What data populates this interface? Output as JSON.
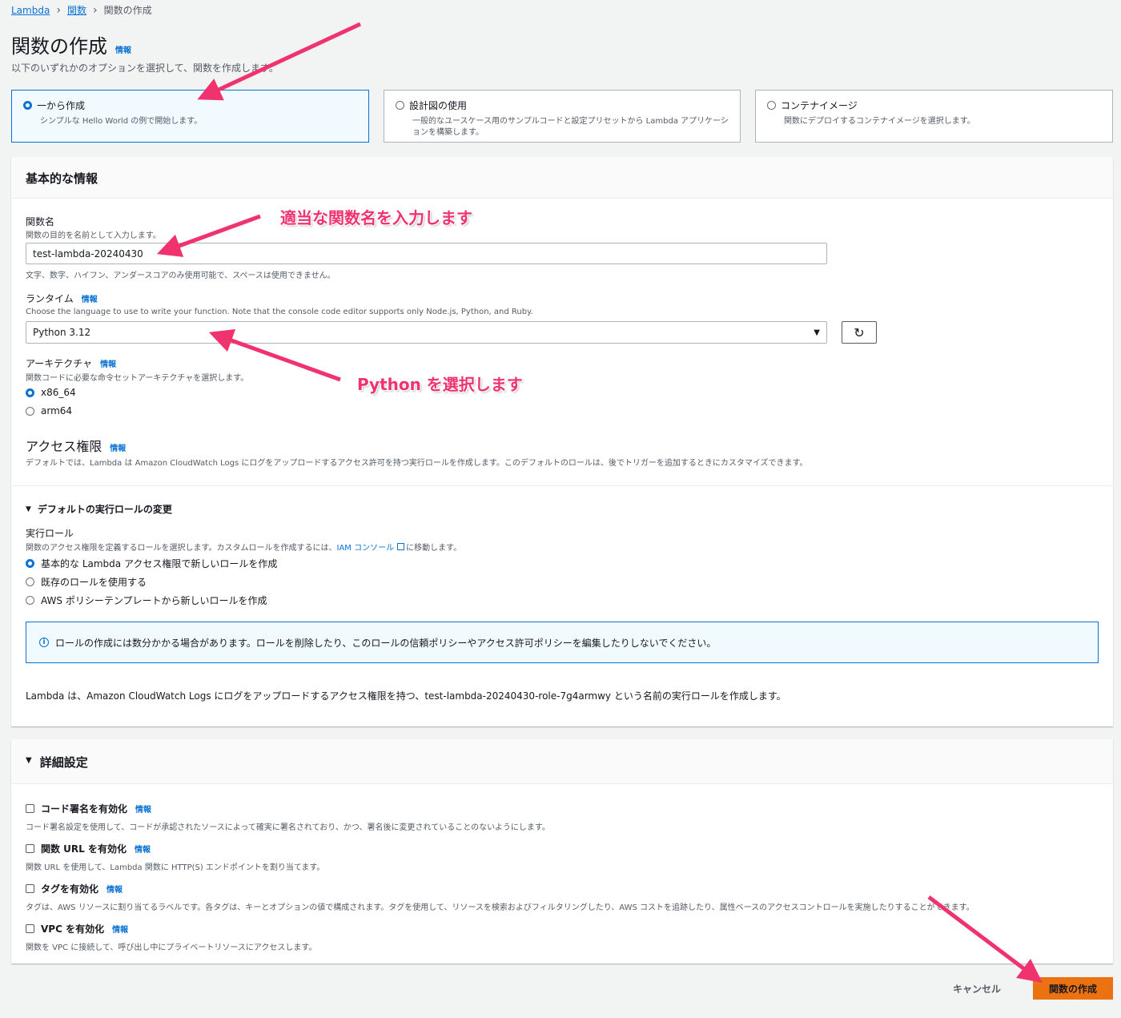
{
  "breadcrumb": {
    "root": "Lambda",
    "functions": "関数",
    "current": "関数の作成"
  },
  "page": {
    "title": "関数の作成",
    "info": "情報",
    "subtitle": "以下のいずれかのオプションを選択して、関数を作成します。"
  },
  "options": [
    {
      "title": "一から作成",
      "desc": "シンプルな Hello World の例で開始します。",
      "selected": true
    },
    {
      "title": "設計図の使用",
      "desc": "一般的なユースケース用のサンプルコードと設定プリセットから Lambda アプリケーションを構築します。",
      "selected": false
    },
    {
      "title": "コンテナイメージ",
      "desc": "関数にデプロイするコンテナイメージを選択します。",
      "selected": false
    }
  ],
  "basic": {
    "header": "基本的な情報",
    "fn_name_label": "関数名",
    "fn_name_desc": "関数の目的を名前として入力します。",
    "fn_name_value": "test-lambda-20240430",
    "fn_name_constraint": "文字、数字、ハイフン、アンダースコアのみ使用可能で、スペースは使用できません。",
    "runtime_label": "ランタイム",
    "runtime_desc": "Choose the language to use to write your function. Note that the console code editor supports only Node.js, Python, and Ruby.",
    "runtime_value": "Python 3.12",
    "arch_label": "アーキテクチャ",
    "arch_desc": "関数コードに必要な命令セットアーキテクチャを選択します。",
    "arch_options": [
      "x86_64",
      "arm64"
    ],
    "perm_title": "アクセス権限",
    "perm_desc": "デフォルトでは、Lambda は Amazon CloudWatch Logs にログをアップロードするアクセス許可を持つ実行ロールを作成します。このデフォルトのロールは、後でトリガーを追加するときにカスタマイズできます。",
    "role_change_header": "デフォルトの実行ロールの変更",
    "exec_role_label": "実行ロール",
    "exec_role_desc_pre": "関数のアクセス権限を定義するロールを選択します。カスタムロールを作成するには、",
    "exec_role_link": "IAM コンソール",
    "exec_role_desc_post": "に移動します。",
    "role_options": [
      "基本的な Lambda アクセス権限で新しいロールを作成",
      "既存のロールを使用する",
      "AWS ポリシーテンプレートから新しいロールを作成"
    ],
    "alert_text": "ロールの作成には数分かかる場合があります。ロールを削除したり、このロールの信頼ポリシーやアクセス許可ポリシーを編集したりしないでください。",
    "role_note": "Lambda は、Amazon CloudWatch Logs にログをアップロードするアクセス権限を持つ、test-lambda-20240430-role-7g4armwy という名前の実行ロールを作成します。"
  },
  "advanced": {
    "header": "詳細設定",
    "items": [
      {
        "title": "コード署名を有効化",
        "desc": "コード署名設定を使用して、コードが承認されたソースによって確実に署名されており、かつ、署名後に変更されていることのないようにします。"
      },
      {
        "title": "関数 URL を有効化",
        "desc": "関数 URL を使用して、Lambda 関数に HTTP(S) エンドポイントを割り当てます。"
      },
      {
        "title": "タグを有効化",
        "desc": "タグは、AWS リソースに割り当てるラベルです。各タグは、キーとオプションの値で構成されます。タグを使用して、リソースを検索およびフィルタリングしたり、AWS コストを追跡したり、属性ベースのアクセスコントロールを実施したりすることができます。"
      },
      {
        "title": "VPC を有効化",
        "desc": "関数を VPC に接続して、呼び出し中にプライベートリソースにアクセスします。"
      }
    ]
  },
  "footer": {
    "cancel": "キャンセル",
    "create": "関数の作成"
  },
  "annotations": {
    "name_hint": "適当な関数名を入力します",
    "runtime_hint": "Python を選択します"
  },
  "colors": {
    "accent": "#0972d3",
    "primary_button": "#ec7211",
    "annotation": "#f0336e"
  }
}
